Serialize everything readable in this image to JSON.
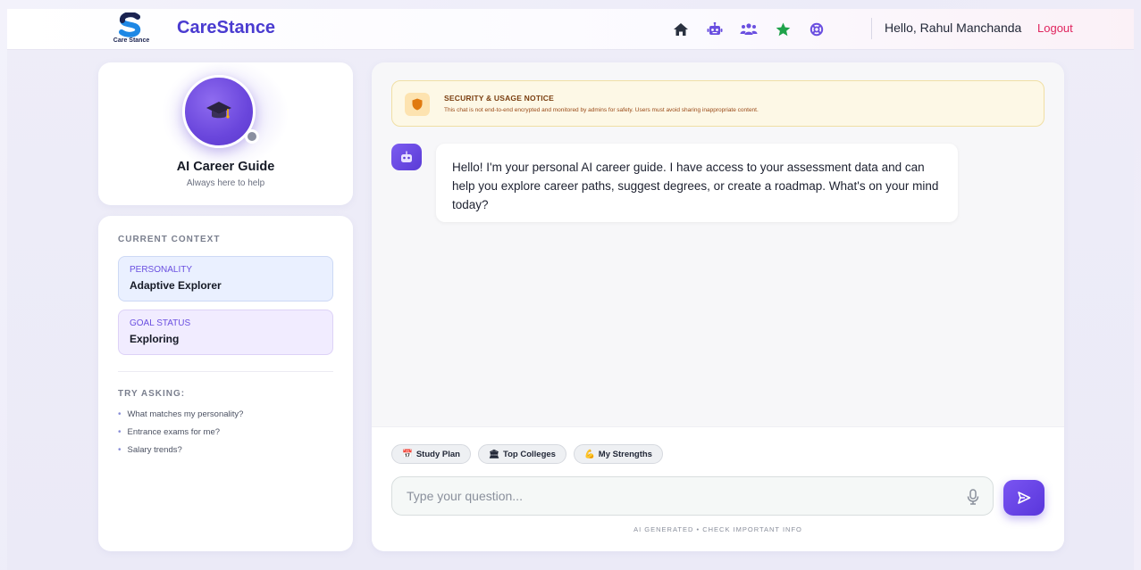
{
  "header": {
    "logo_caption": "Care Stance",
    "brand": "CareStance",
    "nav_icons": [
      "home-icon",
      "robot-icon",
      "users-icon",
      "star-icon",
      "support-icon"
    ],
    "greeting": "Hello, Rahul Manchanda",
    "logout_label": "Logout",
    "colors": {
      "brand": "#4a3bd0",
      "nav_icon": "#6a4fe0",
      "home_icon": "#2a3140",
      "star_icon": "#1fa24a",
      "logout": "#e0245e"
    }
  },
  "profile": {
    "avatar_icon": "graduation-cap-icon",
    "name": "AI Career Guide",
    "subtitle": "Always here to help",
    "status": "offline"
  },
  "context": {
    "section_label": "CURRENT CONTEXT",
    "personality_label": "PERSONALITY",
    "personality_value": "Adaptive Explorer",
    "goal_label": "GOAL STATUS",
    "goal_value": "Exploring",
    "try_label": "TRY ASKING:",
    "suggestions": [
      "What matches my personality?",
      "Entrance exams for me?",
      "Salary trends?"
    ]
  },
  "notice": {
    "icon": "shield-icon",
    "title": "SECURITY & USAGE NOTICE",
    "text": "This chat is not end-to-end encrypted and monitored by admins for safety. Users must avoid sharing inappropriate content."
  },
  "messages": [
    {
      "sender": "bot",
      "avatar_icon": "robot-icon",
      "text": "Hello! I'm your personal AI career guide. I have access to your assessment data and can help you explore career paths, suggest degrees, or create a roadmap. What's on your mind today?"
    }
  ],
  "composer": {
    "chips": [
      {
        "emoji": "📅",
        "label": "Study Plan"
      },
      {
        "emoji": "🏛",
        "label": "Top Colleges"
      },
      {
        "emoji": "💪",
        "label": "My Strengths"
      }
    ],
    "placeholder": "Type your question...",
    "mic_icon": "microphone-icon",
    "send_icon": "send-icon",
    "footnote": "AI GENERATED • CHECK IMPORTANT INFO"
  }
}
